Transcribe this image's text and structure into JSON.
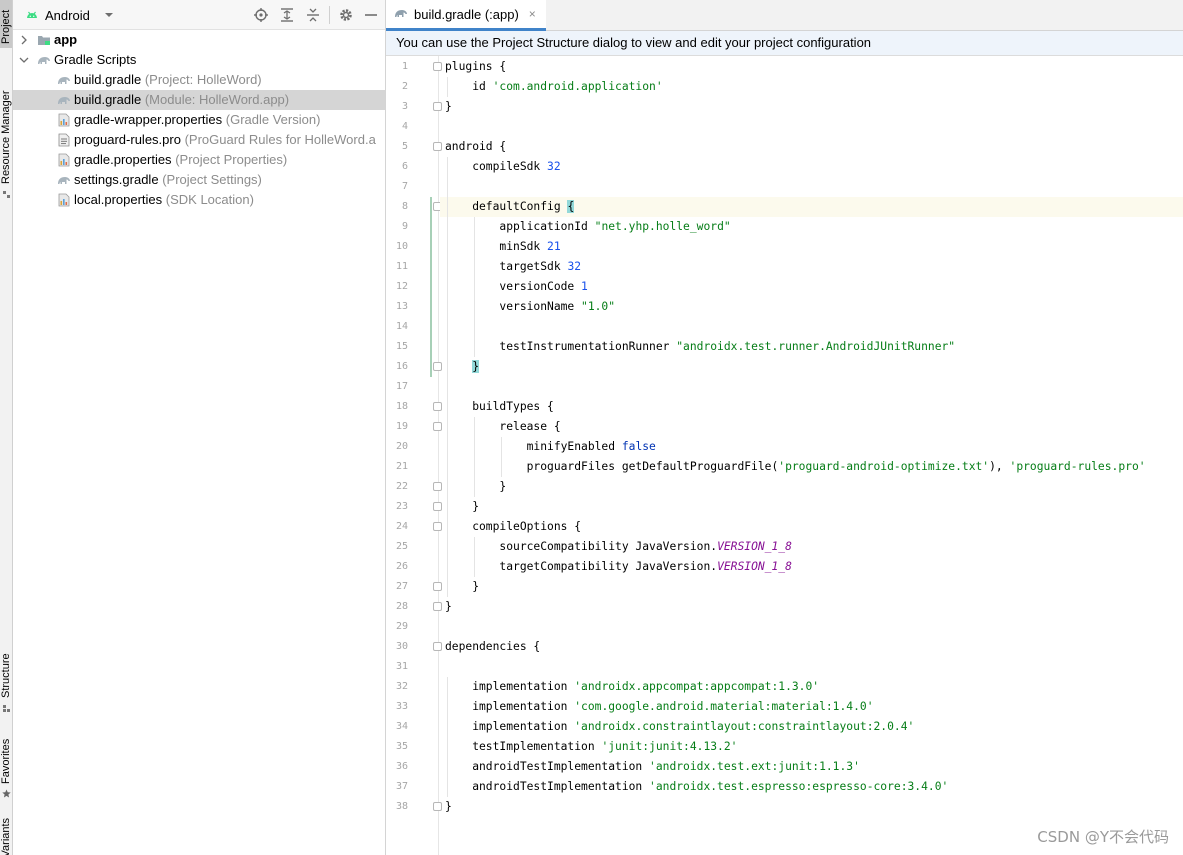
{
  "stripe": {
    "items": [
      {
        "label": "Project"
      },
      {
        "label": "Resource Manager"
      },
      {
        "label": "Structure"
      },
      {
        "label": "Favorites"
      },
      {
        "label": "Build Variants"
      }
    ]
  },
  "project_panel": {
    "view_mode": "Android",
    "toolbar_icons": [
      "locate-icon",
      "expand-all-icon",
      "collapse-all-icon",
      "gear-icon",
      "hide-icon"
    ],
    "tree": [
      {
        "name": "app",
        "hint": "",
        "level": 0,
        "expandable": true,
        "expanded": false,
        "icon": "folder-icon",
        "bold": true
      },
      {
        "name": "Gradle Scripts",
        "hint": "",
        "level": 0,
        "expandable": true,
        "expanded": true,
        "icon": "gradle-elephant-icon",
        "bold": false
      },
      {
        "name": "build.gradle",
        "hint": "(Project: HolleWord)",
        "level": 1,
        "icon": "gradle-elephant-icon"
      },
      {
        "name": "build.gradle",
        "hint": "(Module: HolleWord.app)",
        "level": 1,
        "icon": "gradle-elephant-icon",
        "selected": true
      },
      {
        "name": "gradle-wrapper.properties",
        "hint": "(Gradle Version)",
        "level": 1,
        "icon": "properties-file-icon"
      },
      {
        "name": "proguard-rules.pro",
        "hint": "(ProGuard Rules for HolleWord.a",
        "level": 1,
        "icon": "text-file-icon"
      },
      {
        "name": "gradle.properties",
        "hint": "(Project Properties)",
        "level": 1,
        "icon": "properties-file-icon"
      },
      {
        "name": "settings.gradle",
        "hint": "(Project Settings)",
        "level": 1,
        "icon": "gradle-elephant-icon"
      },
      {
        "name": "local.properties",
        "hint": "(SDK Location)",
        "level": 1,
        "icon": "properties-file-icon"
      }
    ]
  },
  "editor": {
    "tab_label": "build.gradle (:app)",
    "tab_close": "×",
    "banner": "You can use the Project Structure dialog to view and edit your project configuration",
    "current_line": 8,
    "lines": [
      {
        "n": "1",
        "text": "plugins {",
        "fold": true
      },
      {
        "n": "2",
        "text": "    id 'com.android.application'"
      },
      {
        "n": "3",
        "text": "}",
        "fold": true
      },
      {
        "n": "4",
        "text": ""
      },
      {
        "n": "5",
        "text": "android {",
        "fold": true
      },
      {
        "n": "6",
        "text": "    compileSdk 32"
      },
      {
        "n": "7",
        "text": ""
      },
      {
        "n": "8",
        "text": "    defaultConfig {",
        "fold": true
      },
      {
        "n": "9",
        "text": "        applicationId \"net.yhp.holle_word\""
      },
      {
        "n": "10",
        "text": "        minSdk 21"
      },
      {
        "n": "11",
        "text": "        targetSdk 32"
      },
      {
        "n": "12",
        "text": "        versionCode 1"
      },
      {
        "n": "13",
        "text": "        versionName \"1.0\""
      },
      {
        "n": "14",
        "text": ""
      },
      {
        "n": "15",
        "text": "        testInstrumentationRunner \"androidx.test.runner.AndroidJUnitRunner\""
      },
      {
        "n": "16",
        "text": "    }",
        "fold": true
      },
      {
        "n": "17",
        "text": ""
      },
      {
        "n": "18",
        "text": "    buildTypes {",
        "fold": true
      },
      {
        "n": "19",
        "text": "        release {",
        "fold": true
      },
      {
        "n": "20",
        "text": "            minifyEnabled false"
      },
      {
        "n": "21",
        "text": "            proguardFiles getDefaultProguardFile('proguard-android-optimize.txt'), 'proguard-rules.pro'"
      },
      {
        "n": "22",
        "text": "        }",
        "fold": true
      },
      {
        "n": "23",
        "text": "    }",
        "fold": true
      },
      {
        "n": "24",
        "text": "    compileOptions {",
        "fold": true
      },
      {
        "n": "25",
        "text": "        sourceCompatibility JavaVersion.VERSION_1_8"
      },
      {
        "n": "26",
        "text": "        targetCompatibility JavaVersion.VERSION_1_8"
      },
      {
        "n": "27",
        "text": "    }",
        "fold": true
      },
      {
        "n": "28",
        "text": "}",
        "fold": true
      },
      {
        "n": "29",
        "text": ""
      },
      {
        "n": "30",
        "text": "dependencies {",
        "fold": true
      },
      {
        "n": "31",
        "text": ""
      },
      {
        "n": "32",
        "text": "    implementation 'androidx.appcompat:appcompat:1.3.0'"
      },
      {
        "n": "33",
        "text": "    implementation 'com.google.android.material:material:1.4.0'"
      },
      {
        "n": "34",
        "text": "    implementation 'androidx.constraintlayout:constraintlayout:2.0.4'"
      },
      {
        "n": "35",
        "text": "    testImplementation 'junit:junit:4.13.2'"
      },
      {
        "n": "36",
        "text": "    androidTestImplementation 'androidx.test.ext:junit:1.1.3'"
      },
      {
        "n": "37",
        "text": "    androidTestImplementation 'androidx.test.espresso:espresso-core:3.4.0'"
      },
      {
        "n": "38",
        "text": "}",
        "fold": true
      }
    ]
  },
  "watermark": "CSDN @Y不会代码",
  "colors": {
    "keyword": "#0033b3",
    "string": "#067d17",
    "number": "#1750eb",
    "constant": "#871094",
    "android_green": "#3ddc84",
    "gradle_gray": "#a8b4bd",
    "selection": "#d5d5d5",
    "tab_underline": "#4083c9"
  }
}
